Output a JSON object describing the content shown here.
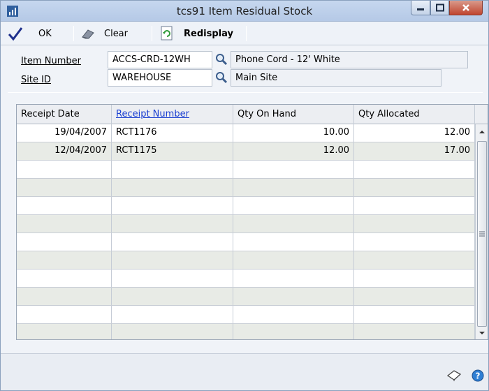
{
  "window": {
    "title": "tcs91 Item Residual Stock"
  },
  "toolbar": {
    "ok_label": "OK",
    "clear_label": "Clear",
    "redisplay_label": "Redisplay"
  },
  "header": {
    "item_number_label": "Item Number",
    "item_number_value": "ACCS-CRD-12WH",
    "item_description": "Phone Cord - 12' White",
    "site_id_label": "Site ID",
    "site_id_value": "WAREHOUSE",
    "site_description": "Main Site"
  },
  "grid": {
    "columns": [
      "Receipt Date",
      "Receipt Number",
      "Qty On Hand",
      "Qty Allocated"
    ],
    "rows": [
      [
        "19/04/2007",
        "RCT1176",
        "10.00",
        "12.00"
      ],
      [
        "12/04/2007",
        "RCT1175",
        "12.00",
        "17.00"
      ]
    ],
    "empty_rows": 10
  },
  "icons": [
    "app-icon",
    "ok-check-icon",
    "clear-eraser-icon",
    "redisplay-icon",
    "lookup-icon",
    "note-icon",
    "help-icon"
  ]
}
